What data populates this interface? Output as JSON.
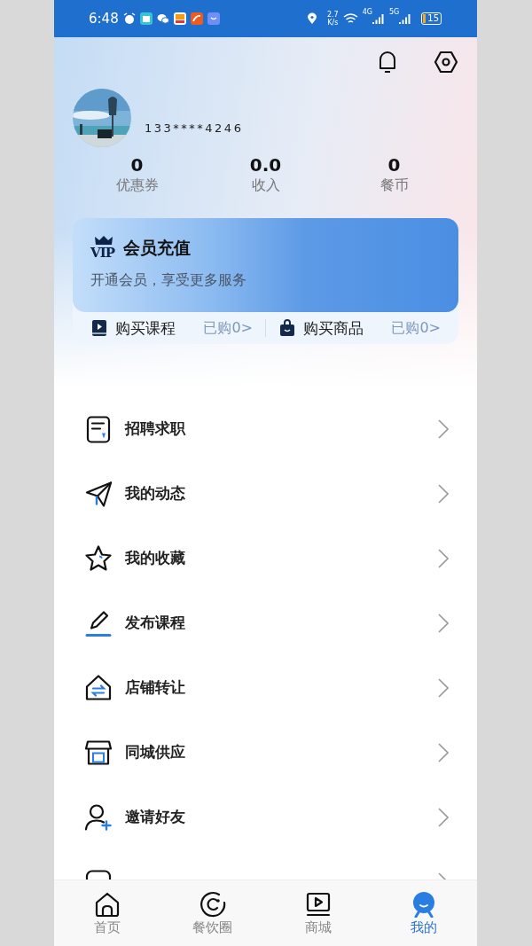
{
  "status_bar": {
    "time": "6:48",
    "speed": "2.7",
    "speed_unit": "K/s",
    "network_1": "4G",
    "network_2": "5G",
    "battery": "15"
  },
  "profile": {
    "phone": "133****4246",
    "stats": [
      {
        "value": "0",
        "label": "优惠券"
      },
      {
        "value": "0.0",
        "label": "收入"
      },
      {
        "value": "0",
        "label": "餐币"
      }
    ]
  },
  "vip": {
    "badge": "VIP",
    "title": "会员充值",
    "subtitle": "开通会员，享受更多服务",
    "purchases": [
      {
        "kind": "course",
        "label": "购买课程",
        "count": "已购0>"
      },
      {
        "kind": "goods",
        "label": "购买商品",
        "count": "已购0>"
      }
    ]
  },
  "menu": [
    {
      "kind": "jobs",
      "label": "招聘求职"
    },
    {
      "kind": "posts",
      "label": "我的动态"
    },
    {
      "kind": "favorites",
      "label": "我的收藏"
    },
    {
      "kind": "publish",
      "label": "发布课程"
    },
    {
      "kind": "transfer",
      "label": "店铺转让"
    },
    {
      "kind": "supply",
      "label": "同城供应"
    },
    {
      "kind": "invite",
      "label": "邀请好友"
    },
    {
      "kind": "join"
    }
  ],
  "tabs": [
    {
      "kind": "home",
      "label": "首页",
      "selected": false
    },
    {
      "kind": "circle",
      "label": "餐饮圈",
      "selected": false
    },
    {
      "kind": "mall",
      "label": "商城",
      "selected": false
    },
    {
      "kind": "me",
      "label": "我的",
      "selected": true
    }
  ]
}
